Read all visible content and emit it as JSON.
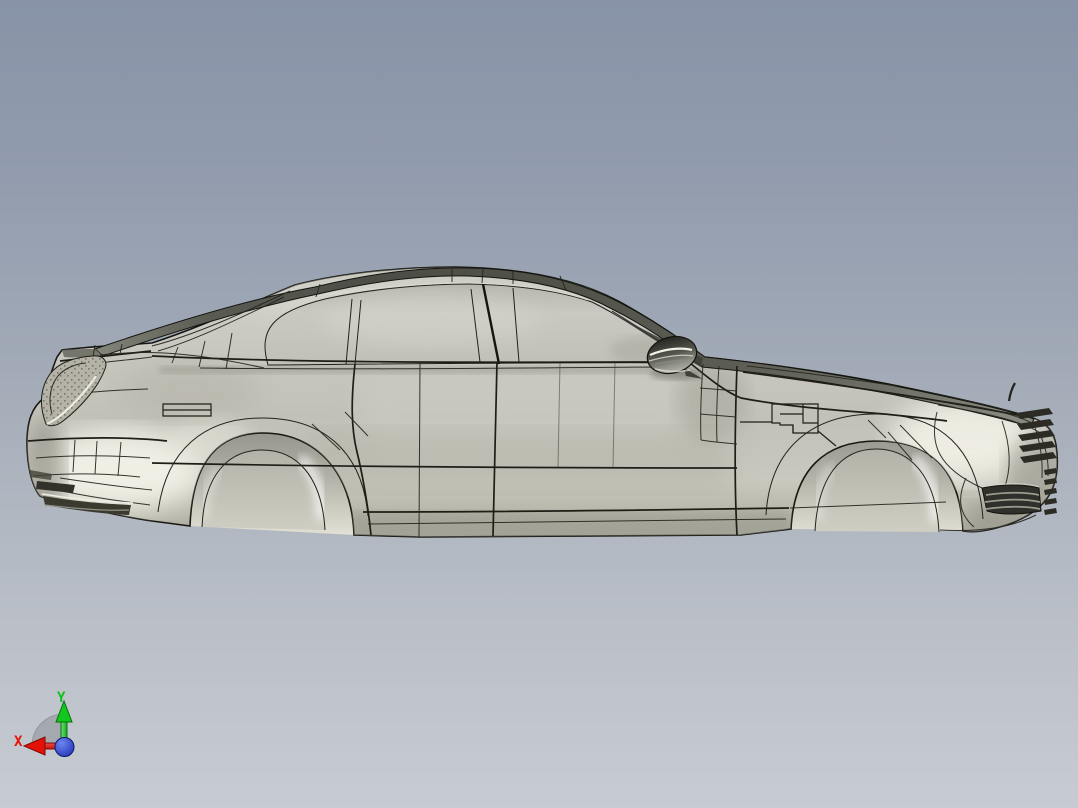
{
  "scene": {
    "background_top_color": "#8893a7",
    "background_bottom_color": "#c7cbd2",
    "model_body_color": "#c9c8c0",
    "model_edge_color": "#1e1e17",
    "model_roof_edge_color": "#4c4e46"
  },
  "triad": {
    "x_label": "X",
    "y_label": "Y",
    "x_color": "#e41108",
    "y_color": "#0fc219",
    "origin_color": "#1b2cb0",
    "plane_color": "#a0a6ab",
    "icons": [
      "x-axis-arrow-icon",
      "y-axis-arrow-icon",
      "z-axis-origin-icon",
      "plane-indicator-icon"
    ]
  }
}
